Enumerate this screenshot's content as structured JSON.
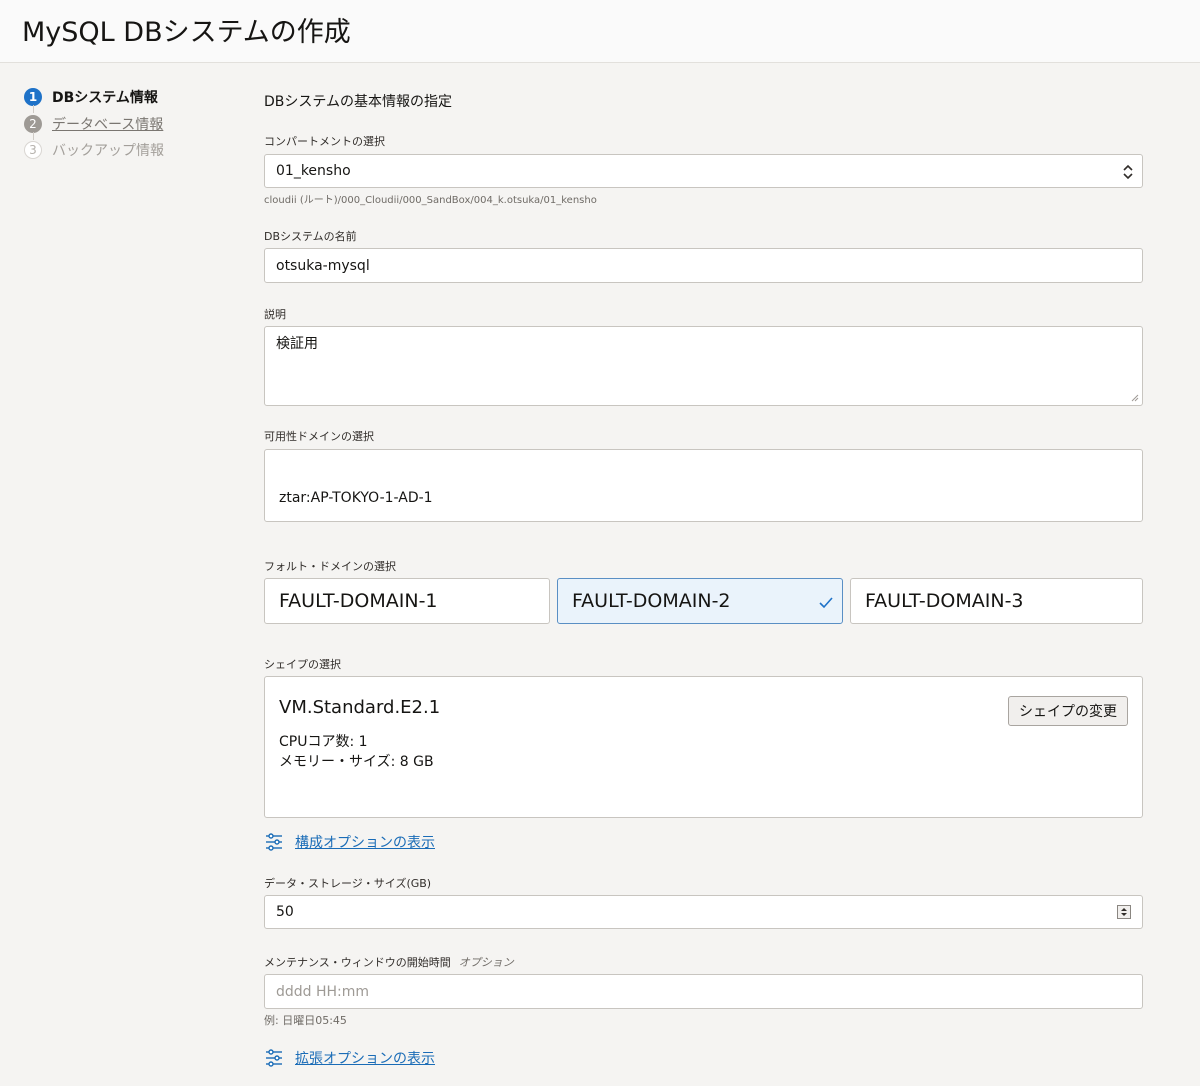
{
  "page": {
    "title": "MySQL DBシステムの作成"
  },
  "steps": [
    {
      "number": "1",
      "label": "DBシステム情報",
      "state": "active"
    },
    {
      "number": "2",
      "label": "データベース情報",
      "state": "visited"
    },
    {
      "number": "3",
      "label": "バックアップ情報",
      "state": "future"
    }
  ],
  "form": {
    "section_title": "DBシステムの基本情報の指定",
    "compartment": {
      "label": "コンパートメントの選択",
      "value": "01_kensho",
      "path": "cloudii (ルート)/000_Cloudii/000_SandBox/004_k.otsuka/01_kensho"
    },
    "name": {
      "label": "DBシステムの名前",
      "value": "otsuka-mysql"
    },
    "description": {
      "label": "説明",
      "value": "検証用"
    },
    "availability_domain": {
      "label": "可用性ドメインの選択",
      "value": "ztar:AP-TOKYO-1-AD-1"
    },
    "fault_domain": {
      "label": "フォルト・ドメインの選択",
      "options": [
        {
          "label": "FAULT-DOMAIN-1",
          "selected": false
        },
        {
          "label": "FAULT-DOMAIN-2",
          "selected": true
        },
        {
          "label": "FAULT-DOMAIN-3",
          "selected": false
        }
      ]
    },
    "shape": {
      "label": "シェイプの選択",
      "name": "VM.Standard.E2.1",
      "cpu": "CPUコア数: 1",
      "memory": "メモリー・サイズ: 8 GB",
      "change_button": "シェイプの変更"
    },
    "config_options_link": "構成オプションの表示",
    "storage": {
      "label": "データ・ストレージ・サイズ(GB)",
      "value": "50"
    },
    "maintenance": {
      "label": "メンテナンス・ウィンドウの開始時間",
      "optional": "オプション",
      "placeholder": "dddd HH:mm",
      "example": "例: 日曜日05:45"
    },
    "advanced_options_link": "拡張オプションの表示"
  },
  "colors": {
    "accent": "#1e72c8",
    "link": "#1a6cb7",
    "selected_bg": "#eaf3fb"
  }
}
